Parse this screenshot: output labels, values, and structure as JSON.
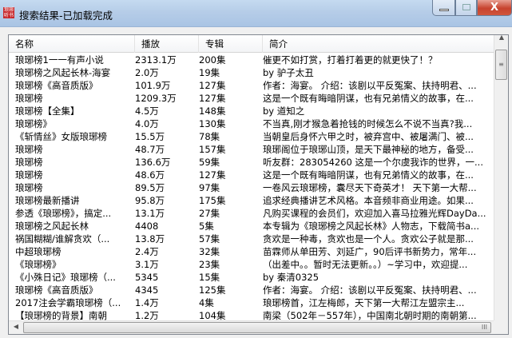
{
  "window": {
    "title": "搜索结果-已加载完成",
    "icon": "app-seal-icon",
    "close_label": "X"
  },
  "columns": [
    "名称",
    "播放",
    "专辑",
    "简介"
  ],
  "rows": [
    [
      "琅琊榜1一一有声小说",
      "2313.1万",
      "200集",
      "催更不如打赏，打着打着更的就更快了！？"
    ],
    [
      "琅琊榜之风起长林-海宴",
      "2.0万",
      "19集",
      "by 驴子太丑"
    ],
    [
      "琅琊榜《高音质版》",
      "101.9万",
      "127集",
      "作者：海宴。 介绍：该剧以平反冤案、扶持明君、..."
    ],
    [
      "琅琊榜",
      "1209.3万",
      "127集",
      "这是一个既有晦暗阴谋，也有兄弟情义的故事，在..."
    ],
    [
      "琅琊榜【全集】",
      "4.5万",
      "148集",
      "by 道知之"
    ],
    [
      "琅琊榜》",
      "4.0万",
      "130集",
      "不当真,刚才猴急着抢钱的时候怎么不说不当真?我..."
    ],
    [
      "《斩情丝》女版琅琊榜",
      "15.5万",
      "78集",
      "当朝皇后身怀六甲之时，被弃宫中、被屠满门、被..."
    ],
    [
      "琅琊榜",
      "48.7万",
      "157集",
      "琅琊阁位于琅琊山顶，是天下最神秘的地方，备受..."
    ],
    [
      "琅琊榜",
      "136.6万",
      "59集",
      "听友群：283054260 这是一个尔虞我诈的世界，一..."
    ],
    [
      "琅琊榜",
      "48.6万",
      "127集",
      "这是一个既有晦暗阴谋，也有兄弟情义的故事，在..."
    ],
    [
      "琅琊榜",
      "89.5万",
      "97集",
      "一卷风云琅琊榜，囊尽天下奇英才！ 天下第一大帮..."
    ],
    [
      "琅琊榜最新播讲",
      "95.8万",
      "175集",
      "追求经典播讲艺术风格。本音频非商业用途。如果..."
    ],
    [
      "参透《琅琊榜》，搞定...",
      "13.1万",
      "27集",
      "凡购买课程的会员们，欢迎加入喜马拉雅光辉DayDa..."
    ],
    [
      "琅琊榜之风起长林",
      "4408",
      "5集",
      "本专辑为《琅琊榜之风起长林》人物志，下载简书a..."
    ],
    [
      "祸国糊糊/谁解贪欢（...",
      "13.8万",
      "57集",
      "贪欢是一种毒，贪欢也是一个人。贪欢公子就是那..."
    ],
    [
      "中超琅琊榜",
      "2.4万",
      "32集",
      "苗霖师从单田芳、刘延广，90后评书新势力，常年..."
    ],
    [
      "《琅琊榜》",
      "3.1万",
      "23集",
      "（出差中。。暂时无法更新。。）~学习中，欢迎提..."
    ],
    [
      "《小殊日记》琅琊榜（...",
      "5345",
      "15集",
      "by 秦清0325"
    ],
    [
      "琅琊榜《高音质版》",
      "4345",
      "125集",
      "作者：海宴。 介绍：该剧以平反冤案、扶持明君、..."
    ],
    [
      "2017注会学霸琅琊榜（...",
      "1.4万",
      "4集",
      "琅琊榜首，江左梅郎，天下第一大帮江左盟宗主..."
    ],
    [
      "【琅琊榜的背景】南朝",
      "1.2万",
      "104集",
      "南梁（502年－557年），中国南北朝时期的南朝第..."
    ]
  ],
  "scrollbars": {
    "horizontal_grip": "III",
    "vertical_grip": "≡"
  }
}
